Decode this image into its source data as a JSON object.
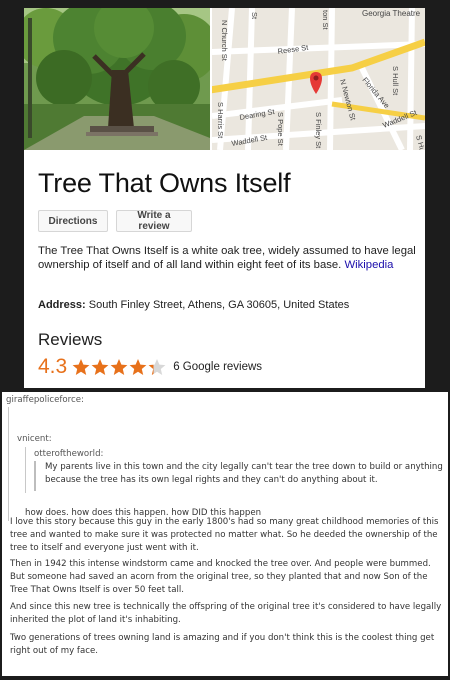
{
  "knowledge_card": {
    "map": {
      "streets": {
        "top_right_label": "Georgia Theatre",
        "s_st": "St",
        "n_church": "N Church St",
        "reese": "Reese St",
        "ton_st": "ton St",
        "s_hull": "S Hull St",
        "florida": "Florida Ave",
        "waddell_right": "Waddell St",
        "n_newton": "N Newton St",
        "dearing": "Dearing St",
        "s_harris": "S Harris St",
        "waddell_left": "Waddell St",
        "s_pope": "S Pope St",
        "s_finley": "S Finley St",
        "s_hull_bottom": "S Hull"
      },
      "marker_color": "#e53935"
    },
    "title": "Tree That Owns Itself",
    "buttons": {
      "directions": "Directions",
      "write_review": "Write a review"
    },
    "description": "The Tree That Owns Itself is a white oak tree, widely assumed to have legal ownership of itself and of all land within eight feet of its base.",
    "source_link": "Wikipedia",
    "address_label": "Address:",
    "address_value": "South Finley Street, Athens, GA 30605, United States",
    "reviews_heading": "Reviews",
    "rating": "4.3",
    "rating_stars_out_of_5": 4.3,
    "review_count": "6 Google reviews",
    "accent_color": "#e7711b"
  },
  "tumblr_post": {
    "top_user": "giraffepoliceforce:",
    "mid_user": "vnicent:",
    "inner_user": "otteroftheworld:",
    "inner_text": "My parents live in this town and the city legally can't tear the tree down to build or anything because the tree has its own legal rights and they can't do anything about it.",
    "reply1": "how does. how does this happen. how DID this happen",
    "paragraphs": [
      "I love this story because this guy in the early 1800's had so many great childhood memories of this tree and wanted to make sure it was protected no matter what. So he deeded the ownership of the tree to itself and everyone just went with it.",
      "Then in 1942 this intense windstorm came and knocked the tree over. And people were bummed. But someone had saved an acorn from the original tree, so they planted that and now Son of the Tree That Owns Itself is over 50 feet tall.",
      "And since this new tree is technically the offspring of the original tree it's considered to have legally inherited the plot of land it's inhabiting.",
      "Two generations of trees owning land is amazing and if you don't think this is the coolest thing get right out of my face."
    ]
  }
}
